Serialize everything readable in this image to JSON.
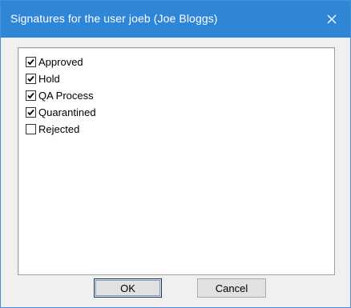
{
  "window": {
    "title": "Signatures for the user joeb (Joe Bloggs)",
    "close_icon": "close-icon",
    "accent_color": "#2f86d6"
  },
  "signatures": [
    {
      "label": "Approved",
      "checked": true
    },
    {
      "label": "Hold",
      "checked": true
    },
    {
      "label": "QA Process",
      "checked": true
    },
    {
      "label": "Quarantined",
      "checked": true
    },
    {
      "label": "Rejected",
      "checked": false
    }
  ],
  "buttons": {
    "ok_label": "OK",
    "cancel_label": "Cancel"
  }
}
